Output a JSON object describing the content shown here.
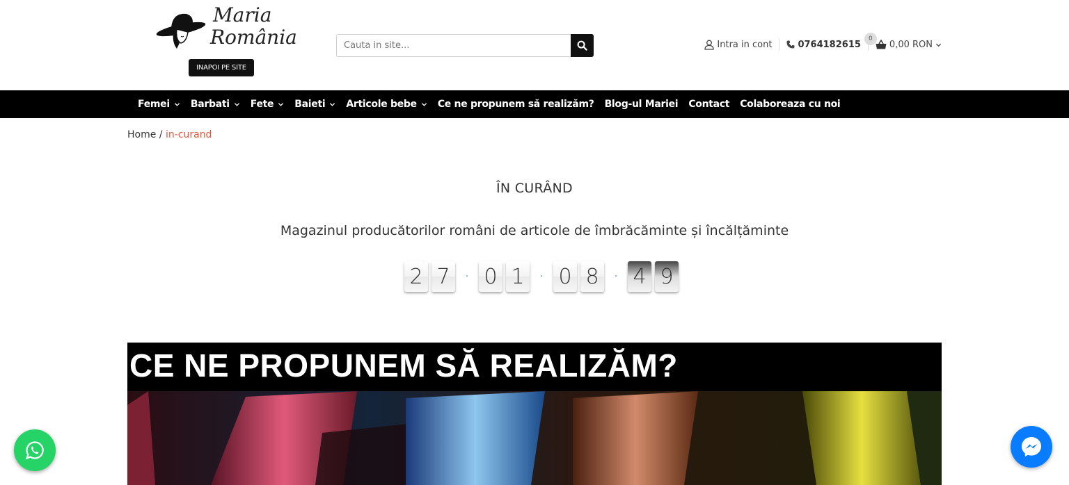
{
  "header": {
    "logo": {
      "line1": "Maria",
      "line2": "România"
    },
    "back_button": "INAPOI PE SITE",
    "search": {
      "placeholder": "Cauta in site...",
      "value": ""
    },
    "account_label": "Intra in cont",
    "phone": "0764182615",
    "cart": {
      "count": "0",
      "total": "0,00 RON"
    }
  },
  "nav": {
    "items": [
      {
        "label": "Femei",
        "has_dropdown": true
      },
      {
        "label": "Barbati",
        "has_dropdown": true
      },
      {
        "label": "Fete",
        "has_dropdown": true
      },
      {
        "label": "Baieti",
        "has_dropdown": true
      },
      {
        "label": "Articole bebe",
        "has_dropdown": true
      },
      {
        "label": "Ce ne propunem să realizăm?",
        "has_dropdown": false
      },
      {
        "label": "Blog-ul Mariei",
        "has_dropdown": false
      },
      {
        "label": "Contact",
        "has_dropdown": false
      },
      {
        "label": "Colaboreaza cu noi",
        "has_dropdown": false
      }
    ]
  },
  "breadcrumb": {
    "home": "Home",
    "separator": " / ",
    "current": "in-curand"
  },
  "coming_soon": {
    "title": "ÎN CURÂND",
    "subtitle": "Magazinul producătorilor români de articole de îmbrăcăminte și încălțăminte",
    "countdown": {
      "days": "27",
      "hours": "01",
      "minutes": "08",
      "seconds": "49"
    }
  },
  "banner": {
    "heading": "CE NE PROPUNEM SĂ REALIZĂM?"
  },
  "icons": {
    "search": "search-icon",
    "account": "user-icon",
    "phone": "phone-icon",
    "cart": "shopping-basket-icon",
    "whatsapp": "whatsapp-icon",
    "messenger": "messenger-icon"
  },
  "colors": {
    "nav_bg": "#000000",
    "accent_breadcrumb": "#e0563c",
    "countdown_separator": "#4a90d9",
    "whatsapp": "#25d366",
    "messenger": "#0a7cff"
  }
}
